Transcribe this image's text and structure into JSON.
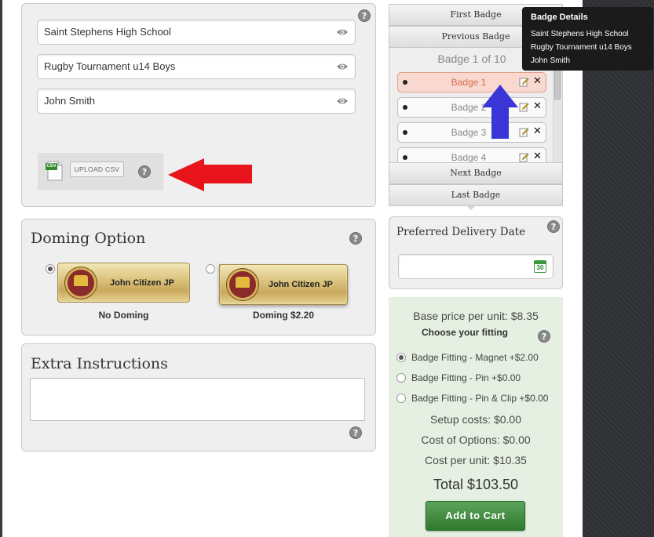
{
  "fields": {
    "school": "Saint Stephens High School",
    "event": "Rugby Tournament u14 Boys",
    "name": "John Smith"
  },
  "upload": {
    "file_icon_label": "CSV",
    "button_label": "UPLOAD CSV"
  },
  "help_glyph": "?",
  "doming": {
    "title": "Doming Option",
    "options": [
      {
        "badge_text": "John Citizen JP",
        "caption": "No Doming",
        "selected": true
      },
      {
        "badge_text": "John Citizen JP",
        "caption": "Doming $2.20",
        "selected": false
      }
    ]
  },
  "extra": {
    "title": "Extra Instructions"
  },
  "badges": {
    "first_label": "First Badge",
    "previous_label": "Previous Badge",
    "counter": "Badge 1 of 10",
    "items": [
      {
        "label": "Badge 1",
        "selected": true
      },
      {
        "label": "Badge 2",
        "selected": false
      },
      {
        "label": "Badge 3",
        "selected": false
      },
      {
        "label": "Badge 4",
        "selected": false
      }
    ],
    "close_glyph": "✕",
    "next_label": "Next Badge",
    "last_label": "Last Badge"
  },
  "tooltip": {
    "title": "Badge Details",
    "lines": [
      "Saint Stephens High School",
      "Rugby Tournament u14 Boys",
      "John Smith"
    ]
  },
  "delivery": {
    "title": "Preferred Delivery Date",
    "value": "",
    "calendar_day": "30"
  },
  "pricing": {
    "base_price": "Base price per unit: $8.35",
    "fitting_heading": "Choose your fitting",
    "fittings": [
      {
        "label": "Badge Fitting - Magnet +$2.00",
        "selected": true
      },
      {
        "label": "Badge Fitting - Pin +$0.00",
        "selected": false
      },
      {
        "label": "Badge Fitting - Pin & Clip +$0.00",
        "selected": false
      }
    ],
    "setup_costs": "Setup costs: $0.00",
    "cost_options": "Cost of Options: $0.00",
    "cost_per_unit": "Cost per unit: $10.35",
    "total": "Total $103.50",
    "add_to_cart": "Add to Cart"
  },
  "colors": {
    "selected_badge_bg": "#f8d8cf",
    "selected_badge_text": "#d86a52",
    "price_panel_bg": "#e5f0e2",
    "cart_button": "#3f8a3d",
    "annotation_red": "#e8141c",
    "annotation_blue": "#3a36d6"
  }
}
